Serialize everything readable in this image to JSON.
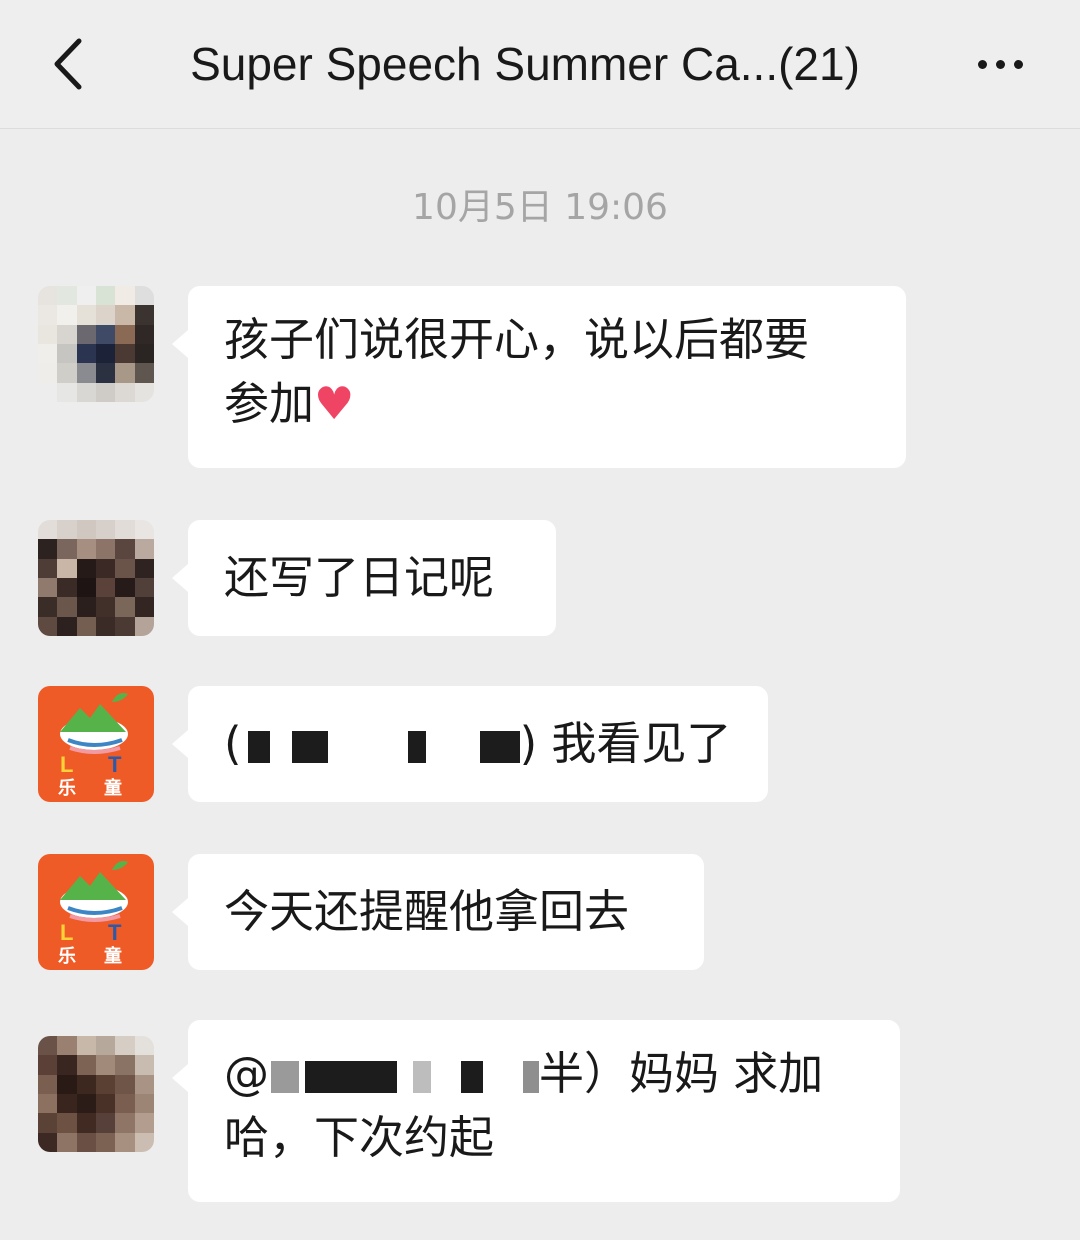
{
  "header": {
    "back_label": "<",
    "title": "Super Speech Summer Ca...(21)",
    "more_label": "..."
  },
  "timestamp": "10月5日 19:06",
  "messages": [
    {
      "lines": [
        "孩子们说很开心，说以后都要",
        "参加"
      ],
      "emoji": "♥"
    },
    {
      "text": "还写了日记呢"
    },
    {
      "prefix": "(",
      "suffix": ") 我看见了"
    },
    {
      "text": "今天还提醒他拿回去"
    },
    {
      "prefix": "@",
      "suffix": "半）妈妈 求加",
      "line2": "哈，下次约起"
    }
  ],
  "logo": {
    "letters": "L T",
    "chinese": "乐 童"
  },
  "colors": {
    "background": "#ededed",
    "bubble": "#ffffff",
    "logo_orange": "#ef5b26",
    "heart": "#f04464"
  }
}
